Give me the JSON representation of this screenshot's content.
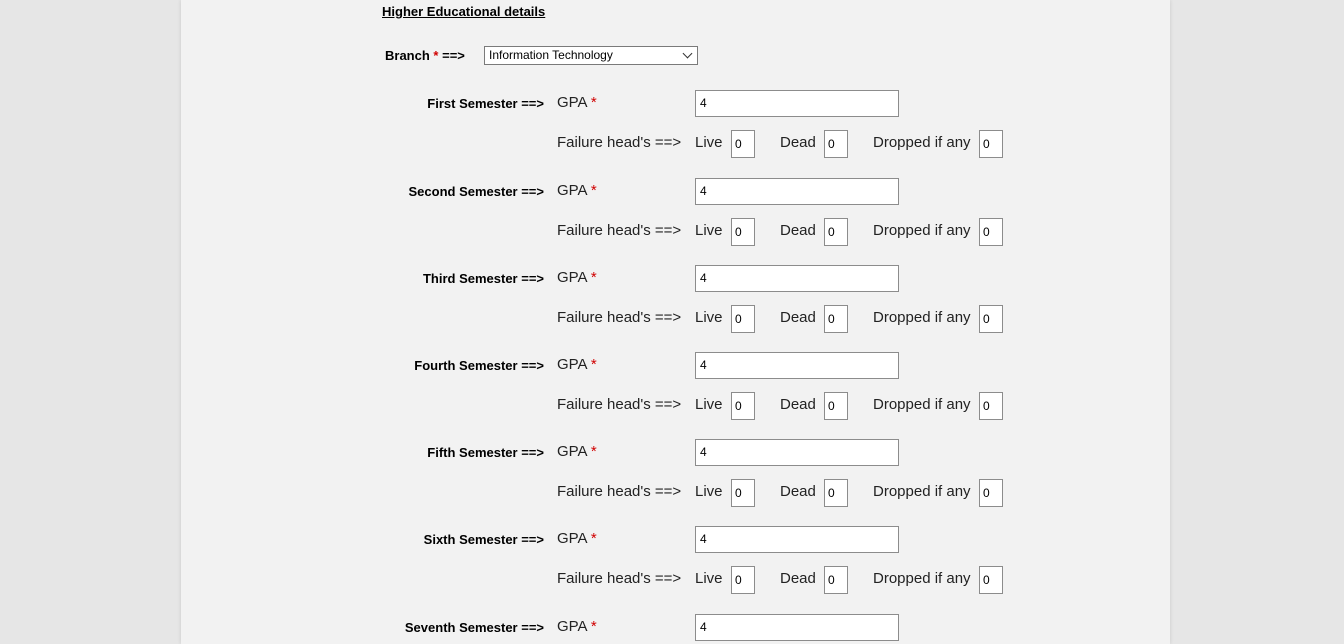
{
  "section_title": "Higher Educational details",
  "branch": {
    "label": "Branch",
    "required_mark": "*",
    "arrow": "==>",
    "selected": "Information Technology"
  },
  "labels": {
    "gpa": "GPA",
    "failure_heads": "Failure head's ==>",
    "live": "Live",
    "dead": "Dead",
    "dropped": "Dropped if any"
  },
  "semesters": [
    {
      "label": "First Semester ==>",
      "gpa": "4",
      "live": "0",
      "dead": "0",
      "dropped": "0"
    },
    {
      "label": "Second Semester ==>",
      "gpa": "4",
      "live": "0",
      "dead": "0",
      "dropped": "0"
    },
    {
      "label": "Third Semester ==>",
      "gpa": "4",
      "live": "0",
      "dead": "0",
      "dropped": "0"
    },
    {
      "label": "Fourth Semester ==>",
      "gpa": "4",
      "live": "0",
      "dead": "0",
      "dropped": "0"
    },
    {
      "label": "Fifth Semester ==>",
      "gpa": "4",
      "live": "0",
      "dead": "0",
      "dropped": "0"
    },
    {
      "label": "Sixth Semester ==>",
      "gpa": "4",
      "live": "0",
      "dead": "0",
      "dropped": "0"
    },
    {
      "label": "Seventh Semester ==>",
      "gpa": "4"
    }
  ]
}
